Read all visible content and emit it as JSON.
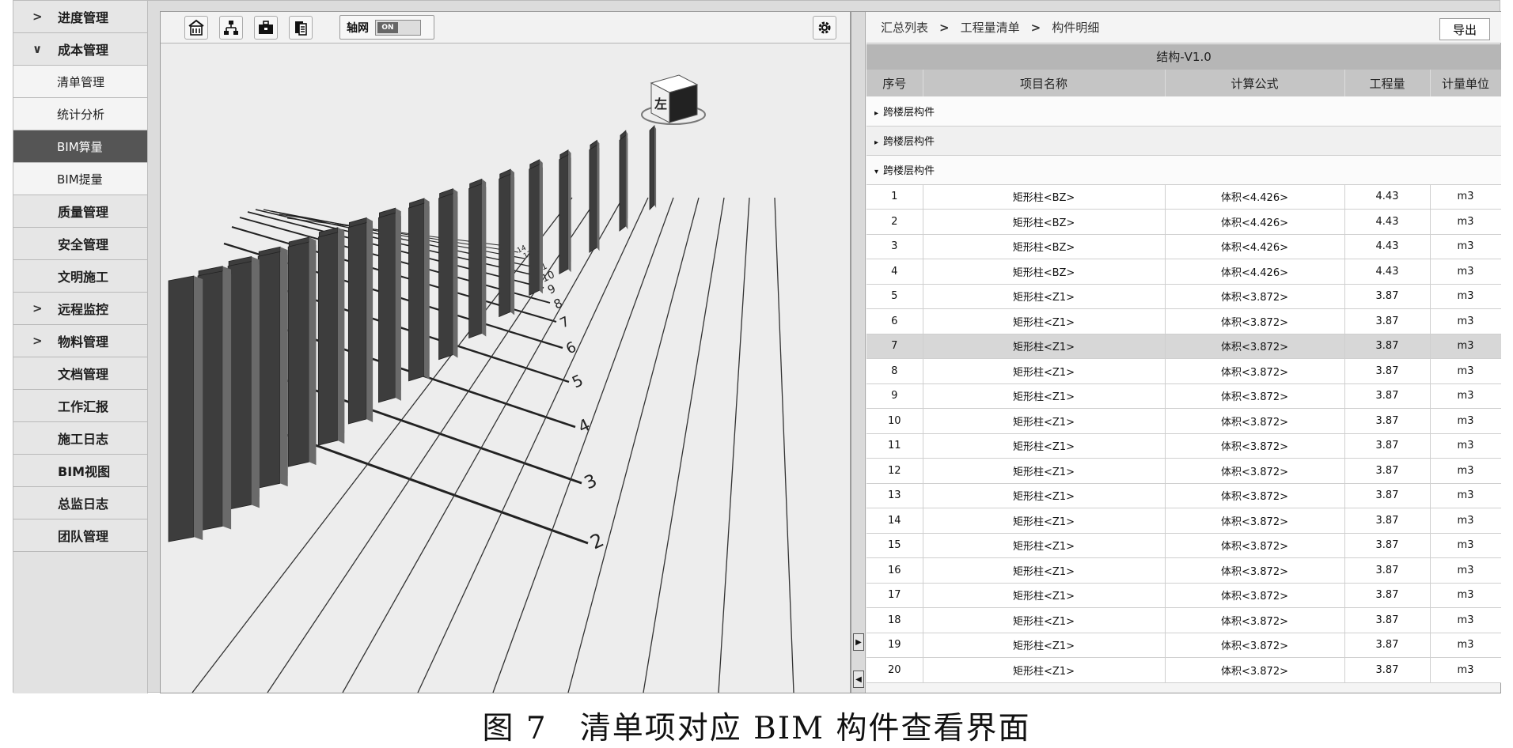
{
  "sidebar": {
    "items": [
      {
        "label": "进度管理",
        "chevron": ">"
      },
      {
        "label": "成本管理",
        "chevron": "∨"
      },
      {
        "label": "清单管理"
      },
      {
        "label": "统计分析"
      },
      {
        "label": "BIM算量"
      },
      {
        "label": "BIM提量"
      },
      {
        "label": "质量管理"
      },
      {
        "label": "安全管理"
      },
      {
        "label": "文明施工"
      },
      {
        "label": "远程监控",
        "chevron": ">"
      },
      {
        "label": "物料管理",
        "chevron": ">"
      },
      {
        "label": "文档管理"
      },
      {
        "label": "工作汇报"
      },
      {
        "label": "施工日志"
      },
      {
        "label": "BIM视图"
      },
      {
        "label": "总监日志"
      },
      {
        "label": "团队管理"
      }
    ]
  },
  "viewer": {
    "toolbar": {
      "icons": [
        "building-icon",
        "hierarchy-icon",
        "toolbox-icon",
        "layers-icon",
        "gear-icon"
      ],
      "axis_label": "轴网",
      "axis_state": "ON"
    },
    "viewcube_label": "左",
    "grid_labels": [
      "2",
      "3",
      "4",
      "5",
      "6",
      "7",
      "8",
      "9",
      "10",
      "11",
      "12",
      "13",
      "14"
    ]
  },
  "panel": {
    "breadcrumb": [
      "汇总列表",
      "工程量清单",
      "构件明细"
    ],
    "breadcrumb_sep": ">",
    "export_label": "导出",
    "version": "结构-V1.0",
    "columns": [
      "序号",
      "项目名称",
      "计算公式",
      "工程量",
      "计量单位"
    ],
    "groups": [
      {
        "label": "跨楼层构件",
        "arrow": "▸"
      },
      {
        "label": "跨楼层构件",
        "arrow": "▸"
      },
      {
        "label": "跨楼层构件",
        "arrow": "▾"
      }
    ],
    "rows": [
      [
        "1",
        "矩形柱<BZ>",
        "体积<4.426>",
        "4.43",
        "m3"
      ],
      [
        "2",
        "矩形柱<BZ>",
        "体积<4.426>",
        "4.43",
        "m3"
      ],
      [
        "3",
        "矩形柱<BZ>",
        "体积<4.426>",
        "4.43",
        "m3"
      ],
      [
        "4",
        "矩形柱<BZ>",
        "体积<4.426>",
        "4.43",
        "m3"
      ],
      [
        "5",
        "矩形柱<Z1>",
        "体积<3.872>",
        "3.87",
        "m3"
      ],
      [
        "6",
        "矩形柱<Z1>",
        "体积<3.872>",
        "3.87",
        "m3"
      ],
      [
        "7",
        "矩形柱<Z1>",
        "体积<3.872>",
        "3.87",
        "m3"
      ],
      [
        "8",
        "矩形柱<Z1>",
        "体积<3.872>",
        "3.87",
        "m3"
      ],
      [
        "9",
        "矩形柱<Z1>",
        "体积<3.872>",
        "3.87",
        "m3"
      ],
      [
        "10",
        "矩形柱<Z1>",
        "体积<3.872>",
        "3.87",
        "m3"
      ],
      [
        "11",
        "矩形柱<Z1>",
        "体积<3.872>",
        "3.87",
        "m3"
      ],
      [
        "12",
        "矩形柱<Z1>",
        "体积<3.872>",
        "3.87",
        "m3"
      ],
      [
        "13",
        "矩形柱<Z1>",
        "体积<3.872>",
        "3.87",
        "m3"
      ],
      [
        "14",
        "矩形柱<Z1>",
        "体积<3.872>",
        "3.87",
        "m3"
      ],
      [
        "15",
        "矩形柱<Z1>",
        "体积<3.872>",
        "3.87",
        "m3"
      ],
      [
        "16",
        "矩形柱<Z1>",
        "体积<3.872>",
        "3.87",
        "m3"
      ],
      [
        "17",
        "矩形柱<Z1>",
        "体积<3.872>",
        "3.87",
        "m3"
      ],
      [
        "18",
        "矩形柱<Z1>",
        "体积<3.872>",
        "3.87",
        "m3"
      ],
      [
        "19",
        "矩形柱<Z1>",
        "体积<3.872>",
        "3.87",
        "m3"
      ],
      [
        "20",
        "矩形柱<Z1>",
        "体积<3.872>",
        "3.87",
        "m3"
      ]
    ],
    "selected_row": "7"
  },
  "caption": "图 7　清单项对应 BIM 构件查看界面",
  "colors": {
    "active": "#555555",
    "selected_row": "#d7d7d7",
    "header": "#c5c5c5",
    "version_bar": "#b6b6b6"
  }
}
